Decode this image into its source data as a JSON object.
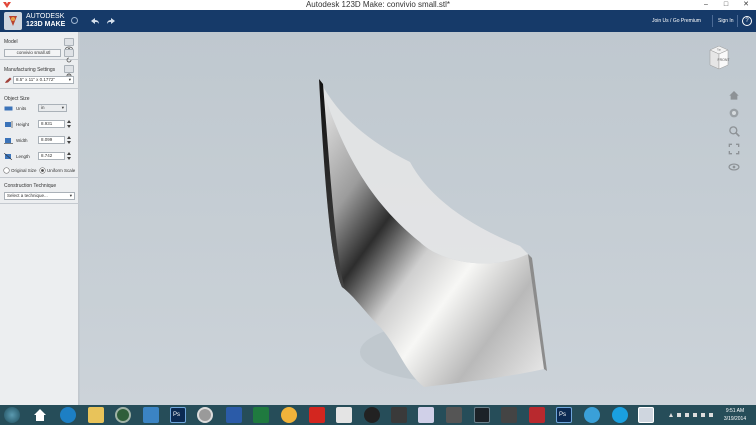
{
  "window": {
    "title": "Autodesk 123D Make: convivio small.stl*"
  },
  "app": {
    "brand_line1": "AUTODESK",
    "brand_line2": "123D MAKE",
    "join_label": "Join Us / Go Premium",
    "signin_label": "Sign In",
    "help_label": "?"
  },
  "panel": {
    "model": {
      "label": "Model",
      "file": "convivio small.stl"
    },
    "manufacturing": {
      "label": "Manufacturing Settings",
      "preset": "8.5\" x 11\" x 0.1772\""
    },
    "object_size": {
      "label": "Object Size",
      "units_label": "Units",
      "units_value": "in",
      "height_label": "Height",
      "height_value": "8.931",
      "width_label": "Width",
      "width_value": "8.099",
      "length_label": "Length",
      "length_value": "8.742",
      "original_size": "Original Size",
      "uniform_scale": "Uniform Scale"
    },
    "construction": {
      "label": "Construction Technique",
      "placeholder": "Select a technique..."
    }
  },
  "viewcube": {
    "face_label": "FRONT",
    "top_label": "Top"
  },
  "taskbar": {
    "time": "9:51 AM",
    "date": "3/19/2014"
  },
  "colors": {
    "header": "#163a69",
    "panel": "#eceef0",
    "viewport": "#c4ccd3",
    "taskbar": "#264d59"
  }
}
